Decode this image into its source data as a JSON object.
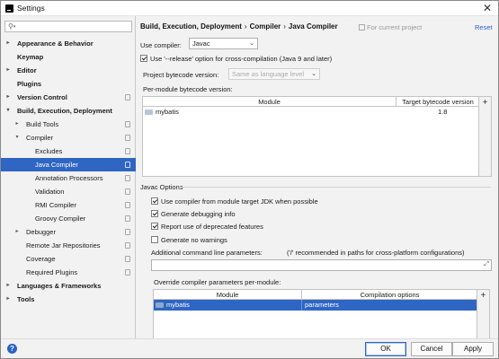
{
  "window": {
    "title": "Settings",
    "close_glyph": "✕"
  },
  "search": {
    "value": ""
  },
  "sidebar": {
    "items": [
      {
        "label": "Appearance & Behavior",
        "bold": true,
        "arrow": "▸"
      },
      {
        "label": "Keymap",
        "bold": true
      },
      {
        "label": "Editor",
        "bold": true,
        "arrow": "▸"
      },
      {
        "label": "Plugins",
        "bold": true
      },
      {
        "label": "Version Control",
        "bold": true,
        "arrow": "▸"
      },
      {
        "label": "Build, Execution, Deployment",
        "bold": true,
        "arrow": "▾"
      },
      {
        "label": "Build Tools",
        "arrow": "▸"
      },
      {
        "label": "Compiler",
        "arrow": "▾"
      },
      {
        "label": "Excludes"
      },
      {
        "label": "Java Compiler",
        "selected": true
      },
      {
        "label": "Annotation Processors"
      },
      {
        "label": "Validation"
      },
      {
        "label": "RMI Compiler"
      },
      {
        "label": "Groovy Compiler"
      },
      {
        "label": "Debugger",
        "arrow": "▸"
      },
      {
        "label": "Remote Jar Repositories"
      },
      {
        "label": "Coverage"
      },
      {
        "label": "Required Plugins"
      },
      {
        "label": "Languages & Frameworks",
        "bold": true,
        "arrow": "▸"
      },
      {
        "label": "Tools",
        "bold": true,
        "arrow": "▸"
      }
    ]
  },
  "breadcrumb": {
    "part1": "Build, Execution, Deployment",
    "part2": "Compiler",
    "part3": "Java Compiler",
    "sep": "›"
  },
  "header": {
    "for_project": "For current project",
    "reset": "Reset"
  },
  "compiler": {
    "use_compiler_label": "Use compiler:",
    "use_compiler_value": "Javac",
    "release_option_label": "Use '--release' option for cross-compilation (Java 9 and later)",
    "release_option_checked": true,
    "bytecode_label": "Project bytecode version:",
    "bytecode_placeholder": "Same as language level",
    "per_module_label": "Per-module bytecode version:",
    "module_table": {
      "headers": [
        "Module",
        "Target bytecode version"
      ],
      "rows": [
        {
          "module": "mybatis",
          "version": "1.8"
        }
      ]
    }
  },
  "javac": {
    "section_title": "Javac Options",
    "options": [
      {
        "label": "Use compiler from module target JDK when possible",
        "checked": true
      },
      {
        "label": "Generate debugging info",
        "checked": true
      },
      {
        "label": "Report use of deprecated features",
        "checked": true
      },
      {
        "label": "Generate no warnings",
        "checked": false
      }
    ],
    "additional_label": "Additional command line parameters:",
    "additional_hint": "('/' recommended in paths for cross-platform configurations)",
    "additional_value": "",
    "override_label": "Override compiler parameters per-module:",
    "override_table": {
      "headers": [
        "Module",
        "Compilation options"
      ],
      "rows": [
        {
          "module": "mybatis",
          "options": "parameters"
        }
      ]
    }
  },
  "footer": {
    "help": "?",
    "ok": "OK",
    "cancel": "Cancel",
    "apply": "Apply"
  },
  "colors": {
    "accent": "#2f66c3",
    "link": "#2a62c8"
  }
}
